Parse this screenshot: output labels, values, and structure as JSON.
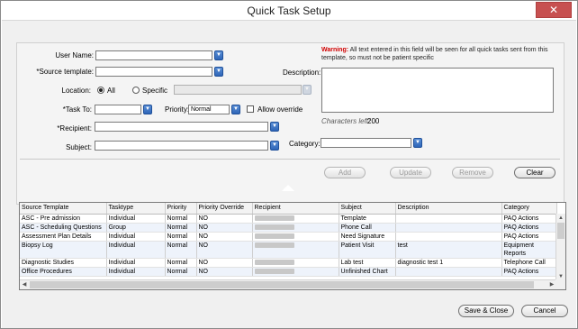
{
  "window": {
    "title": "Quick Task Setup",
    "close_glyph": "✕"
  },
  "form": {
    "user_name_label": "User Name:",
    "source_template_label": "*Source template:",
    "location_label": "Location:",
    "location_all_label": "All",
    "location_specific_label": "Specific",
    "task_to_label": "*Task To:",
    "priority_label": "Priority:",
    "priority_value": "Normal",
    "allow_override_label": "Allow override",
    "recipient_label": "*Recipient:",
    "subject_label": "Subject:",
    "description_label": "Description:",
    "category_label": "Category:",
    "warning_title": "Warning:",
    "warning_text": "All text entered in this field will be seen for all quick tasks sent from this template, so must not be patient specific",
    "chars_left_label": "Characters left:",
    "chars_left_value": "200",
    "dropdown_glyph": "▼"
  },
  "actions": {
    "add": "Add",
    "update": "Update",
    "remove": "Remove",
    "clear": "Clear"
  },
  "grid": {
    "columns": [
      "Source Template",
      "Tasktype",
      "Priority",
      "Priority Override",
      "Recipient",
      "Subject",
      "Description",
      "Category"
    ],
    "rows": [
      [
        "ASC - Pre admission",
        "Individual",
        "Normal",
        "NO",
        "",
        "Template",
        "",
        "PAQ Actions"
      ],
      [
        "ASC - Scheduling Questions",
        "Group",
        "Normal",
        "NO",
        "",
        "Phone Call",
        "",
        "PAQ Actions"
      ],
      [
        "Assessment Plan Details",
        "Individual",
        "Normal",
        "NO",
        "",
        "Need Signature",
        "",
        "PAQ Actions"
      ],
      [
        "Biopsy Log",
        "Individual",
        "Normal",
        "NO",
        "",
        "Patient Visit",
        "test",
        "Equipment Reports"
      ],
      [
        "Diagnostic Studies",
        "Individual",
        "Normal",
        "NO",
        "",
        "Lab test",
        "diagnostic test 1",
        "Telephone Call"
      ],
      [
        "Office Procedures",
        "Individual",
        "Normal",
        "NO",
        "",
        "Unfinished Chart",
        "",
        "PAQ Actions"
      ]
    ]
  },
  "footer": {
    "save_close": "Save & Close",
    "cancel": "Cancel"
  },
  "scroll_glyphs": {
    "up": "▲",
    "down": "▼",
    "left": "◀",
    "right": "▶"
  }
}
